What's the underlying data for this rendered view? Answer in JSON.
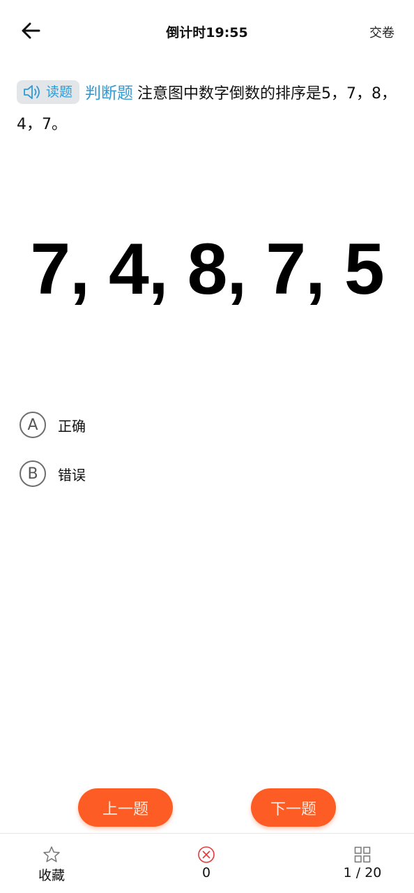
{
  "header": {
    "title": "倒计时19:55",
    "submit_label": "交卷",
    "back_icon": "arrow-left-icon"
  },
  "question": {
    "read_label": "读题",
    "type_label": "判断题",
    "text": "注意图中数字倒数的排序是5，7，8，4，7。"
  },
  "figure": {
    "sequence": "7, 4, 8, 7, 5"
  },
  "options": [
    {
      "letter": "A",
      "text": "正确"
    },
    {
      "letter": "B",
      "text": "错误"
    }
  ],
  "nav": {
    "prev_label": "上一题",
    "next_label": "下一题",
    "accent_color": "#fd5d24"
  },
  "bottom_bar": {
    "favorite_label": "收藏",
    "wrong_count": "0",
    "progress": "1 / 20"
  },
  "colors": {
    "accent_blue": "#2f9ad6",
    "wrong_red": "#e5383b"
  }
}
